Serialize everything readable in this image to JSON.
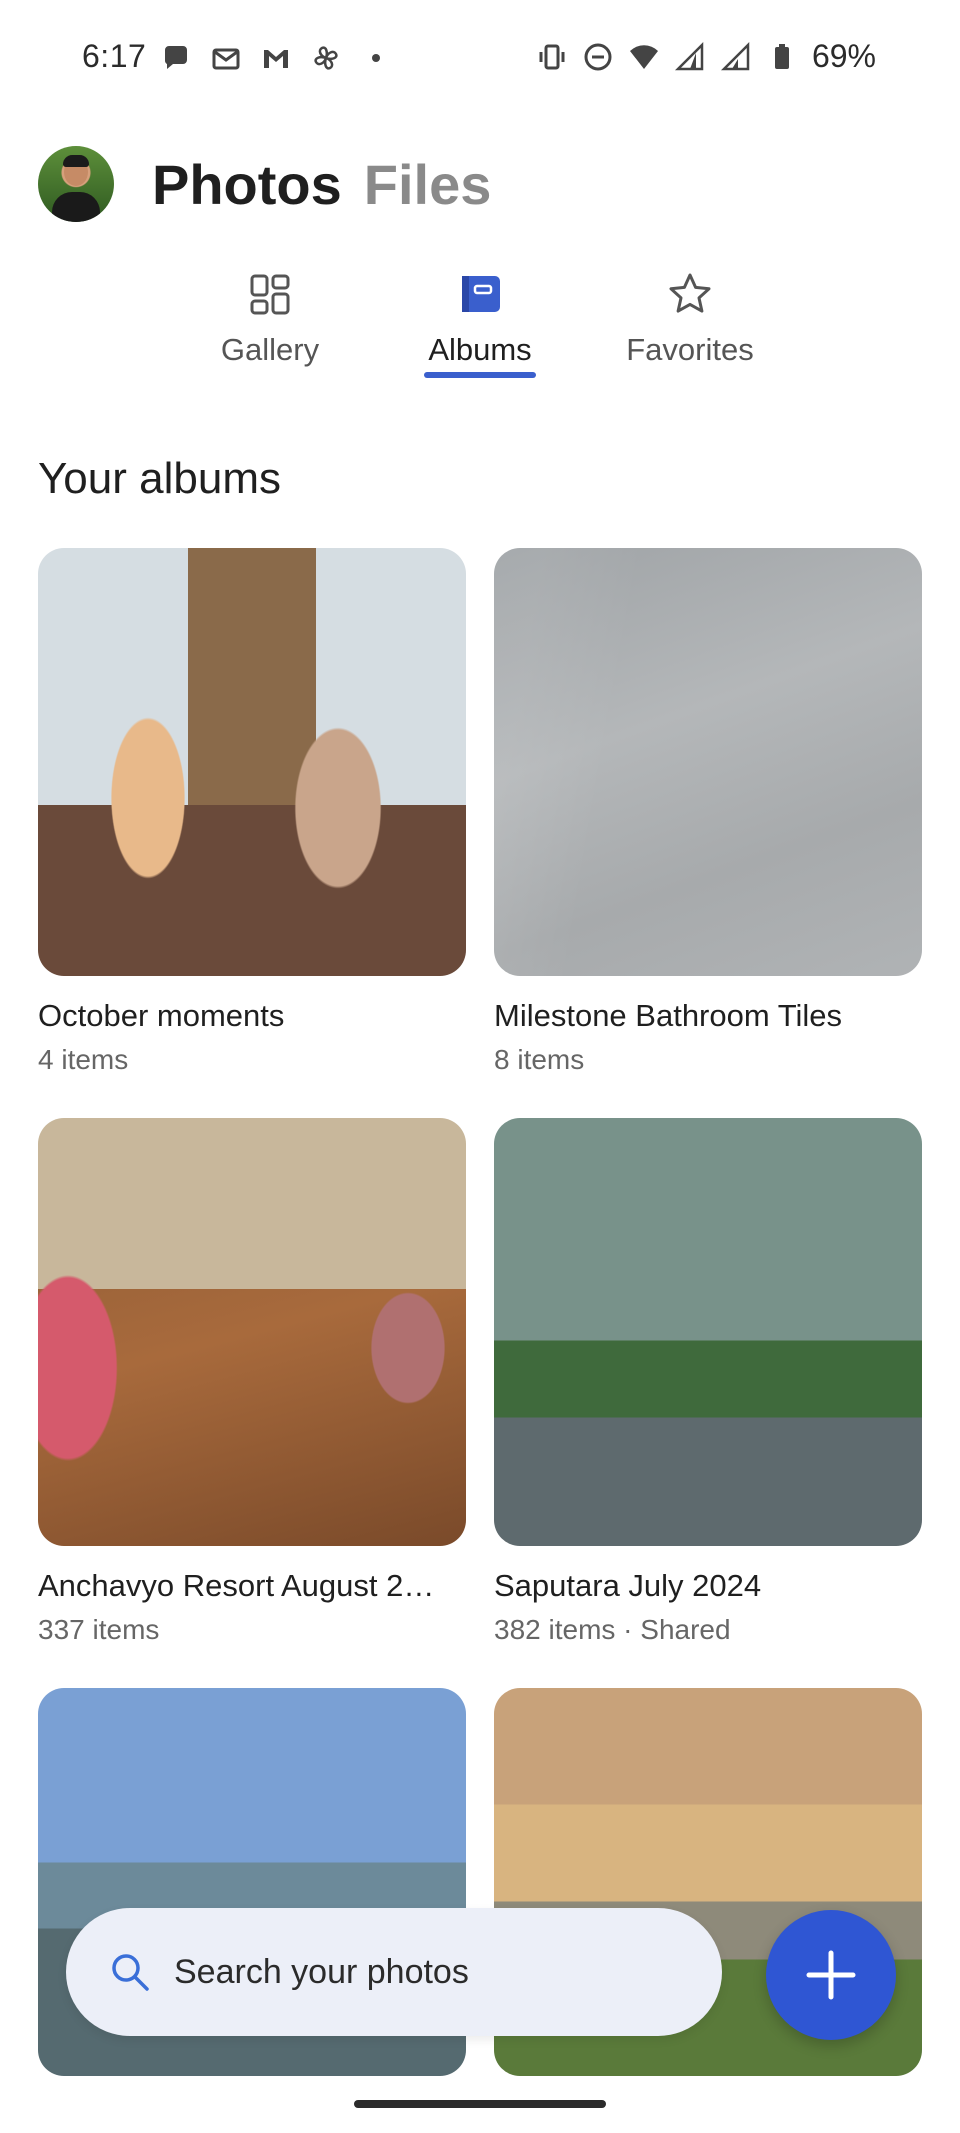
{
  "status_bar": {
    "time": "6:17",
    "battery": "69%"
  },
  "header": {
    "title_active": "Photos",
    "title_inactive": "Files"
  },
  "tabs": [
    {
      "label": "Gallery",
      "icon": "grid-icon",
      "active": false
    },
    {
      "label": "Albums",
      "icon": "album-icon",
      "active": true
    },
    {
      "label": "Favorites",
      "icon": "star-icon",
      "active": false
    }
  ],
  "section": {
    "heading": "Your albums"
  },
  "albums": [
    {
      "title": "October moments",
      "meta": "4 items"
    },
    {
      "title": "Milestone Bathroom Tiles",
      "meta": "8 items"
    },
    {
      "title": "Anchavyo Resort August 2…",
      "meta": "337 items"
    },
    {
      "title": "Saputara July 2024",
      "meta": "382 items · Shared"
    },
    {
      "title": "",
      "meta": ""
    },
    {
      "title": "",
      "meta": ""
    }
  ],
  "search": {
    "placeholder": "Search your photos"
  },
  "colors": {
    "accent": "#3a5fcd",
    "fab": "#2f56d3",
    "search_bg": "#eceff8"
  }
}
